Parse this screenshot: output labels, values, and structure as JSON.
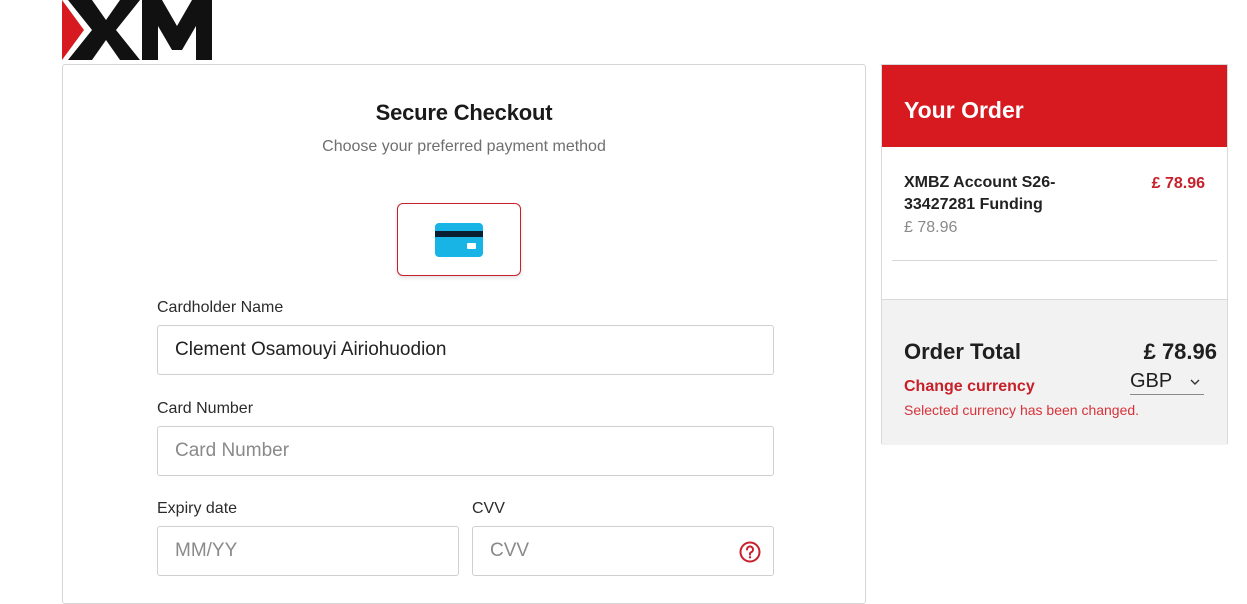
{
  "brand": {
    "logo_text": "XM",
    "accent_color": "#d71920"
  },
  "checkout": {
    "title": "Secure Checkout",
    "subtitle": "Choose your preferred payment method",
    "payment_method_icon": "credit-card-icon",
    "cardholder": {
      "label": "Cardholder Name",
      "value": "Clement Osamouyi Airiohuodion"
    },
    "card_number": {
      "label": "Card Number",
      "placeholder": "Card Number"
    },
    "expiry": {
      "label": "Expiry date",
      "placeholder": "MM/YY"
    },
    "cvv": {
      "label": "CVV",
      "placeholder": "CVV",
      "help_icon": "question-circle-icon"
    }
  },
  "order": {
    "title": "Your Order",
    "item": {
      "name": "XMBZ Account S26-33427281 Funding",
      "price": "£ 78.96",
      "sub_price": "£ 78.96"
    },
    "total_label": "Order Total",
    "total_amount": "£ 78.96",
    "change_currency_label": "Change currency",
    "currency": "GBP",
    "currency_message": "Selected currency has been changed."
  }
}
